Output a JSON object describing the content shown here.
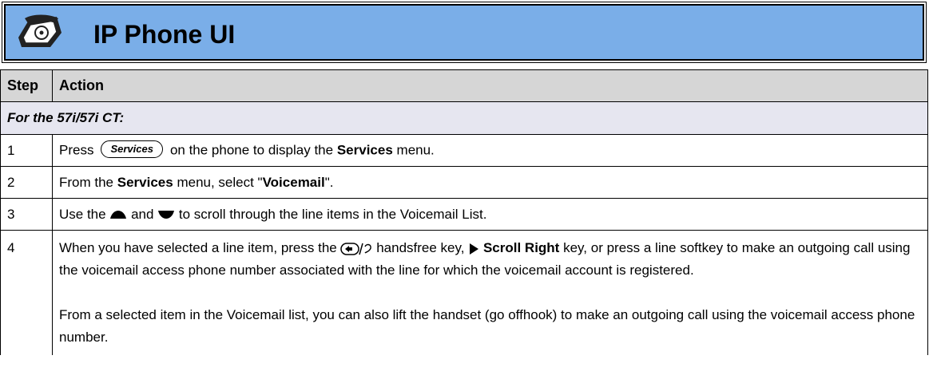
{
  "header": {
    "title": "IP Phone UI",
    "icon": "phone-icon",
    "bg_color": "#7aaee8"
  },
  "table": {
    "columns": [
      "Step",
      "Action"
    ],
    "section": "For the 57i/57i CT:",
    "rows": [
      {
        "step": "1",
        "pre": "Press",
        "key_label": "Services",
        "mid": "on the phone to display the",
        "bold": "Services",
        "post": "menu."
      },
      {
        "step": "2",
        "pre": "From the",
        "bold1": "Services",
        "mid": "menu, select \"",
        "bold2": "Voicemail",
        "post": "\"."
      },
      {
        "step": "3",
        "pre": "Use the",
        "up_icon": "up-arrow-key-icon",
        "mid": "and",
        "down_icon": "down-arrow-key-icon",
        "post": "to scroll through the line items in the Voicemail List."
      },
      {
        "step": "4",
        "pre": "When you have selected a line item, press the",
        "handsfree_icon": "handsfree-key-icon",
        "mid1": "handsfree key,",
        "right_icon": "scroll-right-icon",
        "bold": "Scroll Right",
        "post": "key, or press a line softkey to make an outgoing call using the voicemail access phone number associated with the line for which the voicemail account is registered.",
        "para2": "From a selected item in the Voicemail list, you can also lift the handset (go offhook) to make an outgoing call using the voicemail access phone number."
      }
    ]
  }
}
